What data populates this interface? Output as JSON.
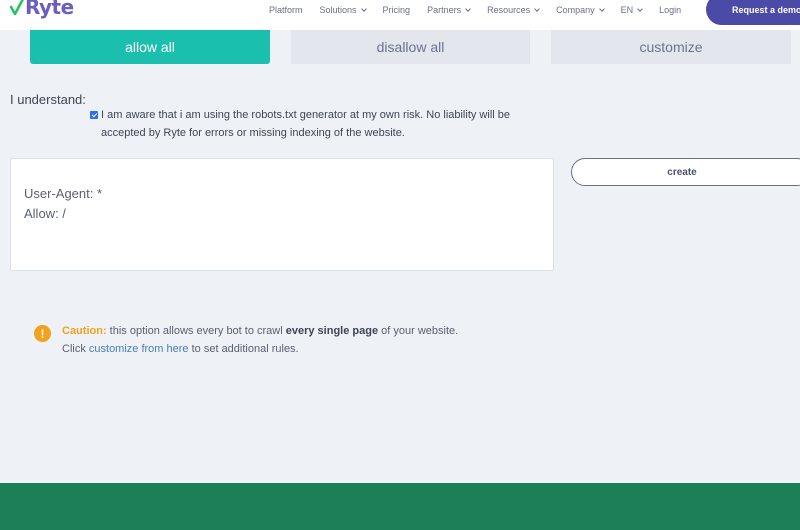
{
  "nav": {
    "logo_text": "Ryte",
    "links": [
      {
        "label": "Platform",
        "dropdown": false
      },
      {
        "label": "Solutions",
        "dropdown": true
      },
      {
        "label": "Pricing",
        "dropdown": false
      },
      {
        "label": "Partners",
        "dropdown": true
      },
      {
        "label": "Resources",
        "dropdown": true
      },
      {
        "label": "Company",
        "dropdown": true
      },
      {
        "label": "EN",
        "dropdown": true
      },
      {
        "label": "Login",
        "dropdown": false
      }
    ],
    "demo_button": "Request a demo"
  },
  "tabs": {
    "allow_all": "allow all",
    "disallow_all": "disallow all",
    "customize": "customize",
    "active": "allow all"
  },
  "understand": {
    "label": "I understand:",
    "checked": true,
    "text": "I am aware that i am using the robots.txt generator at my own risk. No liability will be accepted by Ryte for errors or missing indexing of the website."
  },
  "output": {
    "line1": "User-Agent: *",
    "line2": "Allow: /"
  },
  "create_button": "create",
  "caution": {
    "icon": "exclamation-icon",
    "title": "Caution:",
    "text_before": " this option allows every bot to crawl ",
    "strong": "every single page",
    "text_after": " of your website.",
    "line2_before": "Click ",
    "link": "customize from here",
    "line2_after": " to set additional rules."
  },
  "colors": {
    "accent_teal": "#1bbfae",
    "brand_purple": "#4b4aa6",
    "caution_orange": "#f3a21b",
    "footer_green": "#1c7f58",
    "page_bg": "#eef1f6"
  }
}
